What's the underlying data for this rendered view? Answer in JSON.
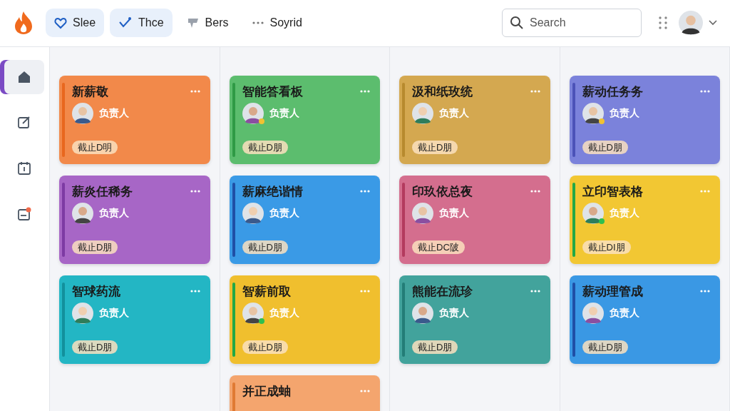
{
  "nav": {
    "items": [
      {
        "label": "Slee",
        "selected": true
      },
      {
        "label": "Thce",
        "selected": true
      },
      {
        "label": "Bers",
        "selected": false
      },
      {
        "label": "Soyrid",
        "selected": false
      }
    ]
  },
  "search": {
    "placeholder": "Search"
  },
  "sidebar": {
    "items": [
      {
        "selected": true
      },
      {
        "selected": false
      },
      {
        "selected": false
      },
      {
        "selected": false
      }
    ]
  },
  "board": {
    "columns": [
      {
        "cards": [
          {
            "title": "新薪敬",
            "owner": "负责人",
            "due": "截止D明",
            "color": "#f2894a",
            "stripe": {
              "color": "#e8671e"
            }
          },
          {
            "title": "薪炎任稀务",
            "owner": "负责人",
            "due": "截止D朋",
            "color": "#a766c6",
            "stripe": {
              "color": "#7d3aa3"
            }
          },
          {
            "title": "智球药流",
            "owner": "负责人",
            "due": "截止D朋",
            "color": "#23b6c4",
            "stripe": {
              "color": "#12909c"
            }
          }
        ]
      },
      {
        "cards": [
          {
            "title": "智能答看板",
            "owner": "负责人",
            "due": "截止D朋",
            "color": "#5cbd6e",
            "stripe": {
              "color": "#2f9a45"
            },
            "status": {
              "color": "#f1c232"
            }
          },
          {
            "title": "薪麻绝谐情",
            "owner": "负责人",
            "due": "截止D朋",
            "color": "#3a9ae6",
            "stripe": {
              "color": "#1f4fa6"
            }
          },
          {
            "title": "智薪前取",
            "owner": "负责人",
            "due": "截止D朋",
            "color": "#f0bf2e",
            "stripe": {
              "color": "#22a846"
            },
            "status": {
              "color": "#2fbf4f"
            }
          },
          {
            "title": "并正成蚰",
            "color": "#f4a56e",
            "stripe": {
              "color": "#e07a33"
            }
          }
        ]
      },
      {
        "cards": [
          {
            "title": "汲和纸玫统",
            "owner": "负责人",
            "due": "截止D朋",
            "color": "#d4a850",
            "stripe": {
              "color": "#b78a2e"
            }
          },
          {
            "title": "印玖依总夜",
            "owner": "负责人",
            "due": "截止DC陂",
            "color": "#d46e8e",
            "stripe": {
              "color": "#b33a5e"
            }
          },
          {
            "title": "熊能在流珍",
            "owner": "负责人",
            "due": "截止D朋",
            "color": "#42a39c",
            "stripe": {
              "color": "#237d77"
            }
          }
        ]
      },
      {
        "cards": [
          {
            "title": "薪动任务务",
            "owner": "负责人",
            "due": "截止D朋",
            "color": "#7b82db",
            "stripe": {
              "color": "#4b52b8"
            },
            "status": {
              "color": "#f1c232"
            }
          },
          {
            "title": "立印智表格",
            "owner": "负责人",
            "due": "截止DI朋",
            "color": "#f2c733",
            "stripe": {
              "color": "#22a846"
            },
            "status": {
              "color": "#2fbf4f"
            }
          },
          {
            "title": "薪动理管成",
            "owner": "负责人",
            "due": "截止D朋",
            "color": "#3a98e4",
            "stripe": {
              "color": "#1f4fa6"
            }
          }
        ]
      }
    ]
  }
}
